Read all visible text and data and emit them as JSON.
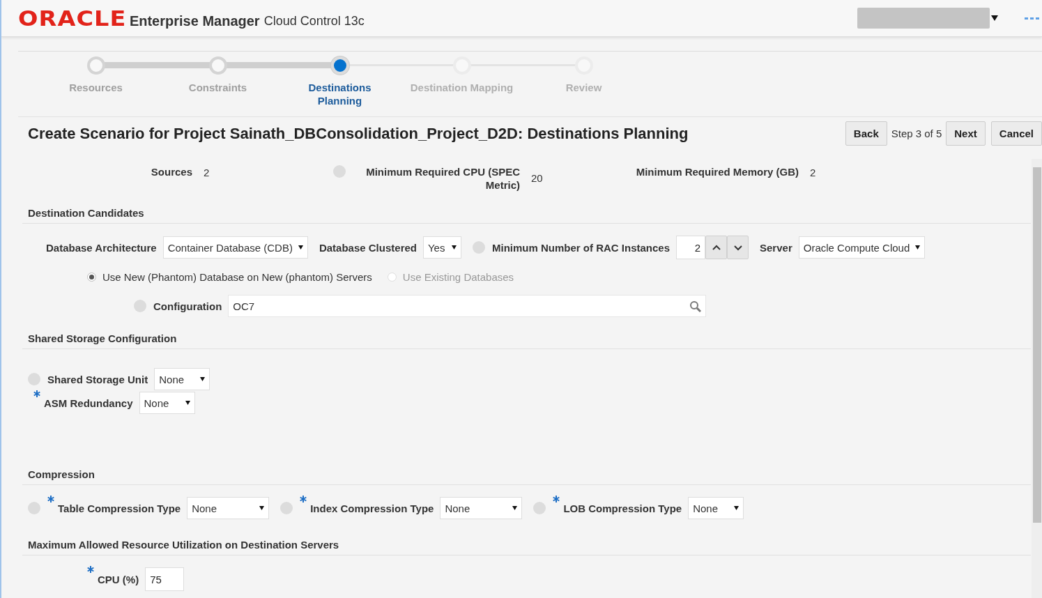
{
  "header": {
    "brand": "ORACLE",
    "product": "Enterprise Manager",
    "subtitle": "Cloud Control 13c"
  },
  "train": [
    {
      "label": "Resources",
      "visited": true,
      "selected": false
    },
    {
      "label": "Constraints",
      "visited": true,
      "selected": false
    },
    {
      "label": "Destinations Planning",
      "visited": true,
      "selected": true
    },
    {
      "label": "Destination Mapping",
      "visited": false,
      "selected": false
    },
    {
      "label": "Review",
      "visited": false,
      "selected": false
    }
  ],
  "title": "Create Scenario for Project Sainath_DBConsolidation_Project_D2D: Destinations Planning",
  "nav": {
    "back": "Back",
    "step": "Step 3 of 5",
    "next": "Next",
    "cancel": "Cancel"
  },
  "summary": [
    {
      "label": "Sources",
      "value": "2",
      "help": false
    },
    {
      "label": "Minimum Required CPU (SPEC Metric)",
      "value": "20",
      "help": true
    },
    {
      "label": "Minimum Required Memory (GB)",
      "value": "2",
      "help": false
    }
  ],
  "sections": [
    {
      "title": "Destination Candidates",
      "rows": [
        {
          "kind": "fields",
          "fields": [
            {
              "kind": "select",
              "label": "Database Architecture",
              "value": "Container Database (CDB)",
              "help": false,
              "required": false
            },
            {
              "kind": "select",
              "label": "Database Clustered",
              "value": "Yes",
              "help": false,
              "required": false
            },
            {
              "kind": "spinner",
              "label": "Minimum Number of RAC Instances",
              "value": "2",
              "help": true,
              "required": false
            },
            {
              "kind": "select",
              "label": "Server",
              "value": "Oracle Compute Cloud",
              "help": false,
              "required": false
            }
          ]
        },
        {
          "kind": "radios",
          "options": [
            {
              "label": "Use New (Phantom) Database on New (phantom) Servers",
              "selected": true,
              "disabled": false
            },
            {
              "label": "Use Existing Databases",
              "selected": false,
              "disabled": true
            }
          ]
        },
        {
          "kind": "fields",
          "fields": [
            {
              "kind": "search",
              "label": "Configuration",
              "value": "OC7",
              "help": true,
              "required": false
            }
          ]
        }
      ]
    },
    {
      "title": "Shared Storage Configuration",
      "rows": [
        {
          "kind": "fields",
          "fields": [
            {
              "kind": "select",
              "label": "Shared Storage Unit",
              "value": "None",
              "help": true,
              "required": false
            }
          ]
        },
        {
          "kind": "fields",
          "fields": [
            {
              "kind": "select",
              "label": "ASM Redundancy",
              "value": "None",
              "help": false,
              "required": true
            }
          ]
        }
      ]
    },
    {
      "title": "Compression",
      "rows": [
        {
          "kind": "fields",
          "fields": [
            {
              "kind": "select",
              "label": "Table Compression Type",
              "value": "None",
              "help": true,
              "required": true
            },
            {
              "kind": "select",
              "label": "Index Compression Type",
              "value": "None",
              "help": true,
              "required": true
            },
            {
              "kind": "select",
              "label": "LOB Compression Type",
              "value": "None",
              "help": true,
              "required": true
            }
          ]
        }
      ]
    },
    {
      "title": "Maximum Allowed Resource Utilization on Destination Servers",
      "rows": [
        {
          "kind": "fields",
          "fields": [
            {
              "kind": "text",
              "label": "CPU (%)",
              "value": "75",
              "help": false,
              "required": true
            }
          ]
        }
      ]
    }
  ]
}
